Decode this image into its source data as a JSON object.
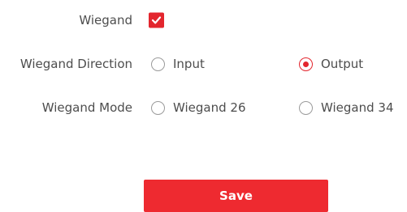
{
  "wiegand": {
    "label": "Wiegand",
    "enabled": true
  },
  "direction": {
    "label": "Wiegand Direction",
    "options": [
      {
        "label": "Input",
        "selected": false
      },
      {
        "label": "Output",
        "selected": true
      }
    ]
  },
  "mode": {
    "label": "Wiegand Mode",
    "options": [
      {
        "label": "Wiegand 26",
        "selected": false
      },
      {
        "label": "Wiegand 34",
        "selected": false
      }
    ]
  },
  "actions": {
    "save_label": "Save"
  },
  "colors": {
    "accent": "#e3262e",
    "button": "#ee2a30",
    "text": "#4d4d4d",
    "radio_border": "#9a9a9a"
  }
}
